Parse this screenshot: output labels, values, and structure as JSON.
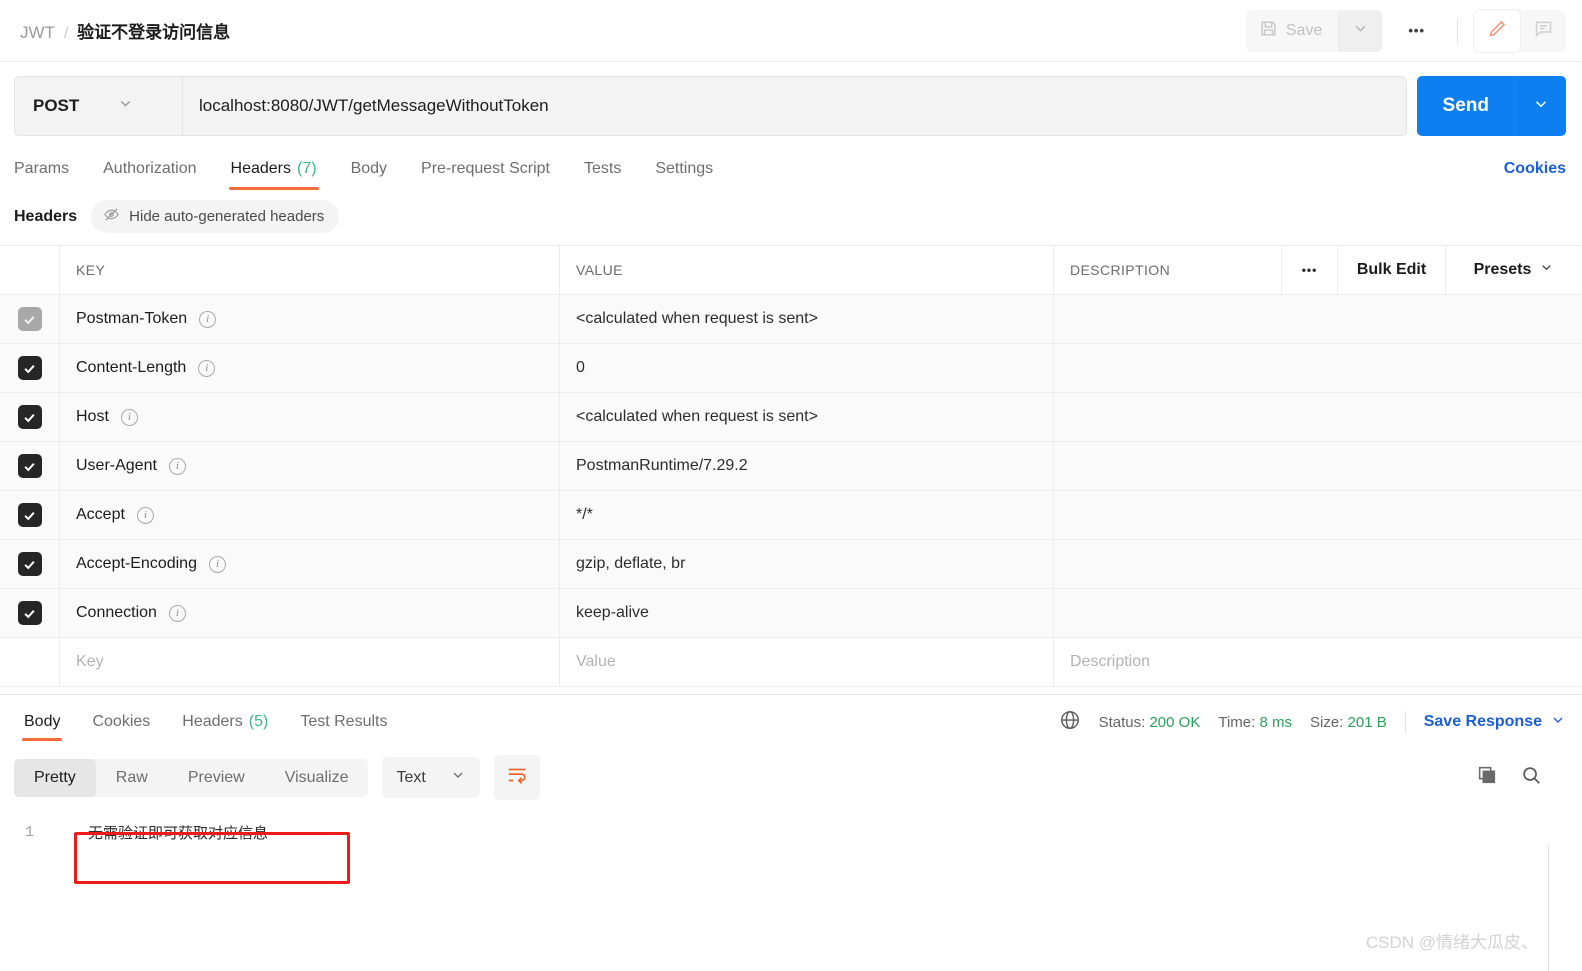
{
  "breadcrumb": {
    "root": "JWT",
    "separator": "/",
    "leaf": "验证不登录访问信息"
  },
  "toolbar": {
    "save_label": "Save",
    "save_caret_icon": "chevron-down-icon",
    "more_label": "•••",
    "edit_icon": "pencil-icon",
    "comment_icon": "comment-icon"
  },
  "url_bar": {
    "method": "POST",
    "method_caret": "chevron-down-icon",
    "url": "localhost:8080/JWT/getMessageWithoutToken",
    "send_label": "Send",
    "send_caret_icon": "chevron-down-icon",
    "send_color": "#0d7ff0"
  },
  "request_tabs": [
    {
      "label": "Params",
      "count": "",
      "active": false
    },
    {
      "label": "Authorization",
      "count": "",
      "active": false
    },
    {
      "label": "Headers",
      "count": "(7)",
      "active": true
    },
    {
      "label": "Body",
      "count": "",
      "active": false
    },
    {
      "label": "Pre-request Script",
      "count": "",
      "active": false
    },
    {
      "label": "Tests",
      "count": "",
      "active": false
    },
    {
      "label": "Settings",
      "count": "",
      "active": false
    }
  ],
  "cookies_link": "Cookies",
  "headers_subbar": {
    "label": "Headers",
    "hide_label": "Hide auto-generated headers",
    "hide_icon": "eye-slash-icon"
  },
  "headers_table": {
    "columns": {
      "key": "KEY",
      "value": "VALUE",
      "description": "DESCRIPTION"
    },
    "actions": {
      "more": "•••",
      "bulk_edit": "Bulk Edit",
      "presets": "Presets",
      "presets_caret": "chevron-down-icon"
    },
    "rows": [
      {
        "checked": true,
        "dim": true,
        "key": "Postman-Token",
        "value": "<calculated when request is sent>",
        "description": ""
      },
      {
        "checked": true,
        "dim": false,
        "key": "Content-Length",
        "value": "0",
        "description": ""
      },
      {
        "checked": true,
        "dim": false,
        "key": "Host",
        "value": "<calculated when request is sent>",
        "description": ""
      },
      {
        "checked": true,
        "dim": false,
        "key": "User-Agent",
        "value": "PostmanRuntime/7.29.2",
        "description": ""
      },
      {
        "checked": true,
        "dim": false,
        "key": "Accept",
        "value": "*/*",
        "description": ""
      },
      {
        "checked": true,
        "dim": false,
        "key": "Accept-Encoding",
        "value": "gzip, deflate, br",
        "description": ""
      },
      {
        "checked": true,
        "dim": false,
        "key": "Connection",
        "value": "keep-alive",
        "description": ""
      }
    ],
    "empty_row": {
      "key_placeholder": "Key",
      "value_placeholder": "Value",
      "description_placeholder": "Description"
    }
  },
  "response_tabs": [
    {
      "label": "Body",
      "count": "",
      "active": true
    },
    {
      "label": "Cookies",
      "count": "",
      "active": false
    },
    {
      "label": "Headers",
      "count": "(5)",
      "active": false
    },
    {
      "label": "Test Results",
      "count": "",
      "active": false
    }
  ],
  "response_meta": {
    "globe_icon": "globe-icon",
    "status_label": "Status:",
    "status_value": "200 OK",
    "time_label": "Time:",
    "time_value": "8 ms",
    "size_label": "Size:",
    "size_value": "201 B",
    "save_response": "Save Response",
    "save_response_caret": "chevron-down-icon",
    "green": "#2aa05a",
    "link_blue": "#1a5fd8"
  },
  "view_toolbar": {
    "modes": [
      {
        "label": "Pretty",
        "active": true
      },
      {
        "label": "Raw",
        "active": false
      },
      {
        "label": "Preview",
        "active": false
      },
      {
        "label": "Visualize",
        "active": false
      }
    ],
    "format": "Text",
    "format_caret": "chevron-down-icon",
    "wrap_icon": "word-wrap-icon",
    "copy_icon": "copy-icon",
    "search_icon": "search-icon"
  },
  "response_body": {
    "line_number": "1",
    "text": "无需验证即可获取对应信息~",
    "highlight_color": "#ef1b1b"
  },
  "watermark": "CSDN @情绪大瓜皮、"
}
